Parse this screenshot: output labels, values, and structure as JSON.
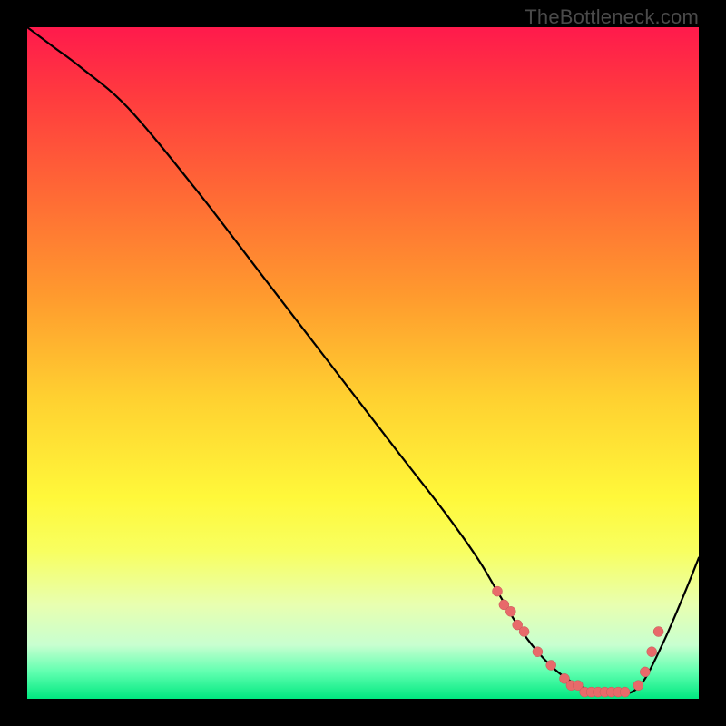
{
  "attribution": "TheBottleneck.com",
  "chart_data": {
    "type": "line",
    "title": "",
    "xlabel": "",
    "ylabel": "",
    "xlim": [
      0,
      100
    ],
    "ylim": [
      0,
      100
    ],
    "background_gradient": [
      "#ff1a4c",
      "#ffd030",
      "#fff83a",
      "#00e880"
    ],
    "series": [
      {
        "name": "bottleneck-curve",
        "color": "#000000",
        "x": [
          0,
          4,
          8,
          15,
          25,
          35,
          45,
          55,
          62,
          67,
          70,
          73,
          76,
          79,
          82,
          85,
          88,
          90,
          92,
          95,
          98,
          100
        ],
        "y": [
          100,
          97,
          94,
          88,
          76,
          63,
          50,
          37,
          28,
          21,
          16,
          11,
          7,
          4,
          2,
          1,
          1,
          1,
          3,
          9,
          16,
          21
        ]
      }
    ],
    "highlight_points": {
      "name": "marked-region",
      "color": "#e86a6a",
      "x": [
        70,
        71,
        72,
        73,
        74,
        76,
        78,
        80,
        81,
        82,
        83,
        84,
        85,
        86,
        87,
        88,
        89,
        91,
        92,
        93,
        94
      ],
      "y": [
        16,
        14,
        13,
        11,
        10,
        7,
        5,
        3,
        2,
        2,
        1,
        1,
        1,
        1,
        1,
        1,
        1,
        2,
        4,
        7,
        10
      ]
    }
  }
}
